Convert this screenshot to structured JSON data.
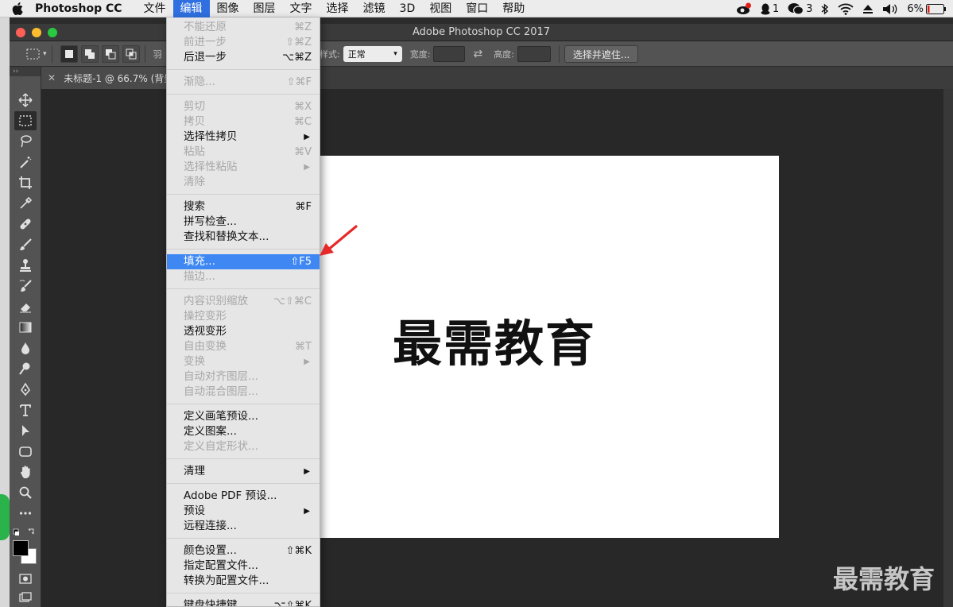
{
  "menubar": {
    "app_name": "Photoshop CC",
    "menus": [
      "文件",
      "编辑",
      "图像",
      "图层",
      "文字",
      "选择",
      "滤镜",
      "3D",
      "视图",
      "窗口",
      "帮助"
    ],
    "active_index": 1,
    "status": {
      "qq_count": "1",
      "wechat_count": "3",
      "battery": "6%"
    }
  },
  "window": {
    "title": "Adobe Photoshop CC 2017"
  },
  "options": {
    "feather_label": "羽",
    "style_label": "样式:",
    "style_value": "正常",
    "width_label": "宽度:",
    "height_label": "高度:",
    "select_mask_button": "选择并遮住..."
  },
  "tools": {
    "collapse": "››"
  },
  "document": {
    "tab_label": "未标题-1 @ 66.7% (背景"
  },
  "canvas": {
    "text": "最需教育"
  },
  "watermark": {
    "text": "最需教育"
  },
  "edit_menu": {
    "items": [
      {
        "label": "不能还原",
        "shortcut": "⌘Z",
        "disabled": true
      },
      {
        "label": "前进一步",
        "shortcut": "⇧⌘Z",
        "disabled": true
      },
      {
        "label": "后退一步",
        "shortcut": "⌥⌘Z",
        "disabled": false
      },
      {
        "label": "渐隐...",
        "shortcut": "⇧⌘F",
        "disabled": true
      },
      {
        "label": "剪切",
        "shortcut": "⌘X",
        "disabled": true
      },
      {
        "label": "拷贝",
        "shortcut": "⌘C",
        "disabled": true
      },
      {
        "label": "选择性拷贝",
        "shortcut": "▶",
        "disabled": false
      },
      {
        "label": "粘贴",
        "shortcut": "⌘V",
        "disabled": true
      },
      {
        "label": "选择性粘贴",
        "shortcut": "▶",
        "disabled": true
      },
      {
        "label": "清除",
        "shortcut": "",
        "disabled": true
      },
      {
        "label": "搜索",
        "shortcut": "⌘F",
        "disabled": false
      },
      {
        "label": "拼写检查...",
        "shortcut": "",
        "disabled": false
      },
      {
        "label": "查找和替换文本...",
        "shortcut": "",
        "disabled": false
      },
      {
        "label": "填充...",
        "shortcut": "⇧F5",
        "disabled": false,
        "highlighted": true
      },
      {
        "label": "描边...",
        "shortcut": "",
        "disabled": true
      },
      {
        "label": "内容识别缩放",
        "shortcut": "⌥⇧⌘C",
        "disabled": true
      },
      {
        "label": "操控变形",
        "shortcut": "",
        "disabled": true
      },
      {
        "label": "透视变形",
        "shortcut": "",
        "disabled": false
      },
      {
        "label": "自由变换",
        "shortcut": "⌘T",
        "disabled": true
      },
      {
        "label": "变换",
        "shortcut": "▶",
        "disabled": true
      },
      {
        "label": "自动对齐图层...",
        "shortcut": "",
        "disabled": true
      },
      {
        "label": "自动混合图层...",
        "shortcut": "",
        "disabled": true
      },
      {
        "label": "定义画笔预设...",
        "shortcut": "",
        "disabled": false
      },
      {
        "label": "定义图案...",
        "shortcut": "",
        "disabled": false
      },
      {
        "label": "定义自定形状...",
        "shortcut": "",
        "disabled": true
      },
      {
        "label": "清理",
        "shortcut": "▶",
        "disabled": false
      },
      {
        "label": "Adobe PDF 预设...",
        "shortcut": "",
        "disabled": false
      },
      {
        "label": "预设",
        "shortcut": "▶",
        "disabled": false
      },
      {
        "label": "远程连接...",
        "shortcut": "",
        "disabled": false
      },
      {
        "label": "颜色设置...",
        "shortcut": "⇧⌘K",
        "disabled": false
      },
      {
        "label": "指定配置文件...",
        "shortcut": "",
        "disabled": false
      },
      {
        "label": "转换为配置文件...",
        "shortcut": "",
        "disabled": false
      },
      {
        "label": "键盘快捷键...",
        "shortcut": "⌥⇧⌘K",
        "disabled": false
      }
    ]
  },
  "colors": {
    "menu_highlight": "#3f88f4",
    "arrow": "#e62a2a"
  }
}
